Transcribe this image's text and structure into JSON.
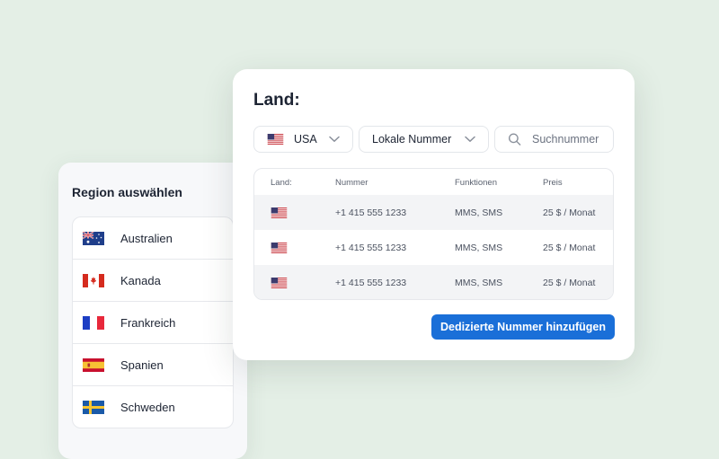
{
  "region_panel": {
    "title": "Region auswählen",
    "items": [
      {
        "label": "Australien",
        "flag": "australia-flag-icon"
      },
      {
        "label": "Kanada",
        "flag": "canada-flag-icon"
      },
      {
        "label": "Frankreich",
        "flag": "france-flag-icon"
      },
      {
        "label": "Spanien",
        "flag": "spain-flag-icon"
      },
      {
        "label": "Schweden",
        "flag": "sweden-flag-icon"
      }
    ]
  },
  "main_panel": {
    "title": "Land:",
    "filters": {
      "country": {
        "value": "USA",
        "flag": "usa-flag-icon"
      },
      "number_type": {
        "value": "Lokale Nummer"
      },
      "search": {
        "placeholder": "Suchnummer",
        "value": ""
      }
    },
    "table": {
      "columns": [
        "Land:",
        "Nummer",
        "Funktionen",
        "Preis"
      ],
      "rows": [
        {
          "flag": "usa-flag-icon",
          "number": "+1 415 555 1233",
          "features": "MMS, SMS",
          "price": "25 $ / Monat"
        },
        {
          "flag": "usa-flag-icon",
          "number": "+1 415 555 1233",
          "features": "MMS, SMS",
          "price": "25 $ / Monat"
        },
        {
          "flag": "usa-flag-icon",
          "number": "+1 415 555 1233",
          "features": "MMS, SMS",
          "price": "25 $ / Monat"
        }
      ]
    },
    "add_button_label": "Dedizierte Nummer hinzufügen"
  },
  "colors": {
    "background": "#e4efe6",
    "accent": "#1a6fd8",
    "row_shade": "#f3f4f6"
  }
}
